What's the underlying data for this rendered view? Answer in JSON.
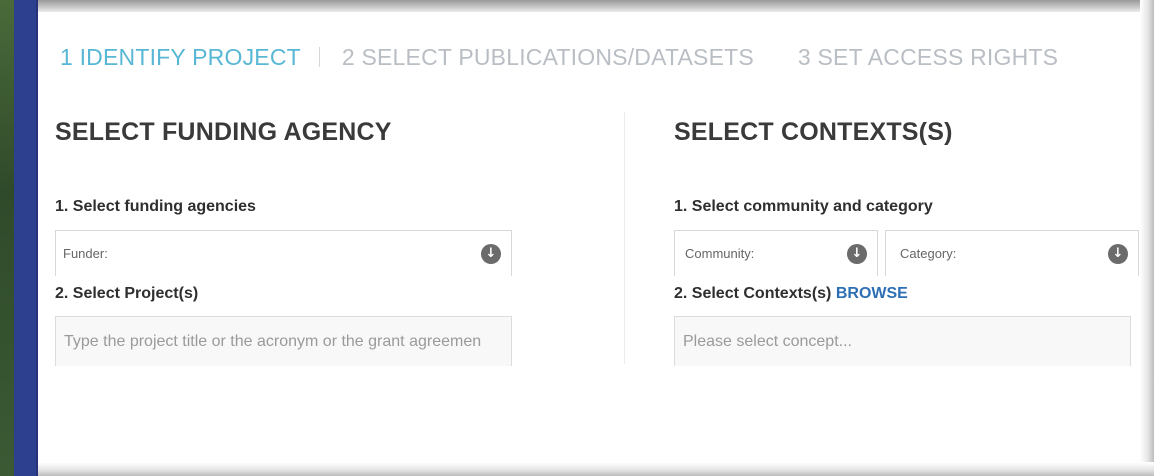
{
  "steps": [
    {
      "label": "1 IDENTIFY PROJECT",
      "state": "active"
    },
    {
      "label": "2 SELECT PUBLICATIONS/DATASETS",
      "state": "inactive"
    },
    {
      "label": "3 SET ACCESS RIGHTS",
      "state": "inactive"
    }
  ],
  "funding": {
    "title": "SELECT FUNDING AGENCY",
    "step1": "1. Select funding agencies",
    "funder_label": "Funder:",
    "step2": "2. Select Project(s)",
    "project_placeholder": "Type the project title or the acronym or the grant agreemen"
  },
  "contexts": {
    "title": "SELECT CONTEXTS(S)",
    "step1": "1. Select community and category",
    "community_label": "Community:",
    "category_label": "Category:",
    "step2": "2. Select Contexts(s)",
    "browse": "BROWSE",
    "concept_placeholder": "Please select concept..."
  },
  "icons": {
    "dropdown": "circle-down-arrow-icon"
  },
  "colors": {
    "active_step": "#58b7d4",
    "inactive_step": "#b9bec4",
    "link": "#2d6fb5",
    "side_bar": "#2d3f8f"
  }
}
